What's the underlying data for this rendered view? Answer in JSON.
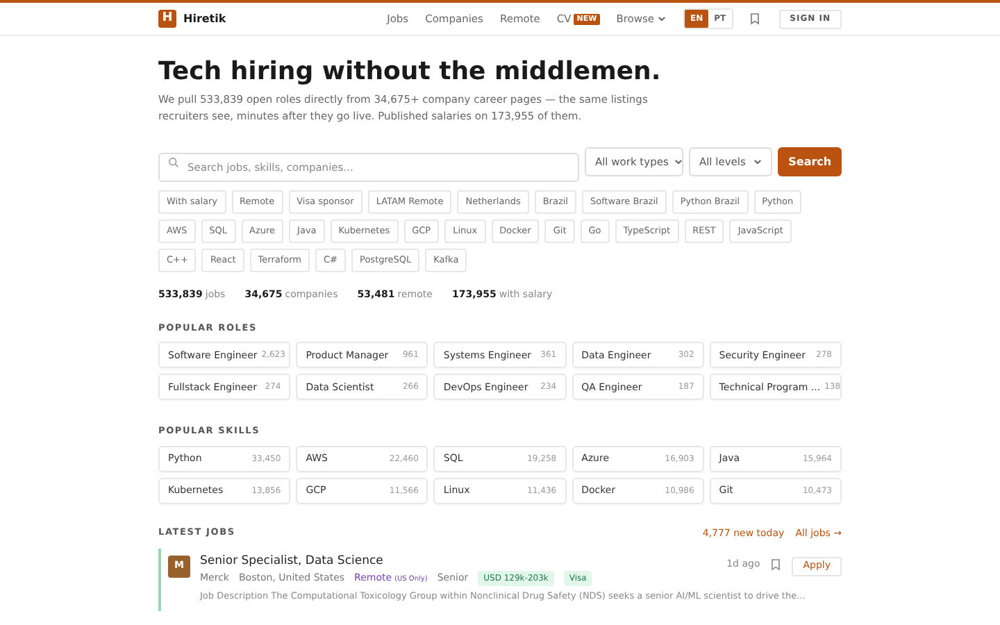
{
  "header": {
    "logo_letter": "H",
    "brand": "Hiretik",
    "nav": [
      {
        "label": "Jobs",
        "kind": "link"
      },
      {
        "label": "Companies",
        "kind": "link"
      },
      {
        "label": "Remote",
        "kind": "link"
      },
      {
        "label": "CV",
        "kind": "badge",
        "badge": "NEW"
      },
      {
        "label": "Browse",
        "kind": "menu"
      }
    ],
    "languages": [
      {
        "label": "EN",
        "selected": true
      },
      {
        "label": "PT",
        "selected": false
      }
    ],
    "sign_in": "SIGN IN"
  },
  "hero": {
    "title": "Tech hiring without the middlemen.",
    "subtitle": "We pull 533,839 open roles directly from 34,675+ company career pages — the same listings recruiters see, minutes after they go live. Published salaries on 173,955 of them."
  },
  "search": {
    "placeholder": "Search jobs, skills, companies...",
    "work_type": "All work types",
    "level": "All levels",
    "button": "Search"
  },
  "chips": [
    "With salary",
    "Remote",
    "Visa sponsor",
    "LATAM Remote",
    "Netherlands",
    "Brazil",
    "Software Brazil",
    "Python Brazil",
    "Python",
    "AWS",
    "SQL",
    "Azure",
    "Java",
    "Kubernetes",
    "GCP",
    "Linux",
    "Docker",
    "Git",
    "Go",
    "TypeScript",
    "REST",
    "JavaScript",
    "C++",
    "React",
    "Terraform",
    "C#",
    "PostgreSQL",
    "Kafka"
  ],
  "stats": [
    {
      "value": "533,839",
      "label": "jobs"
    },
    {
      "value": "34,675",
      "label": "companies"
    },
    {
      "value": "53,481",
      "label": "remote"
    },
    {
      "value": "173,955",
      "label": "with salary"
    }
  ],
  "popular_roles": {
    "title": "POPULAR ROLES",
    "items": [
      {
        "name": "Software Engineer",
        "count": "2,623"
      },
      {
        "name": "Product Manager",
        "count": "961"
      },
      {
        "name": "Systems Engineer",
        "count": "361"
      },
      {
        "name": "Data Engineer",
        "count": "302"
      },
      {
        "name": "Security Engineer",
        "count": "278"
      },
      {
        "name": "Fullstack Engineer",
        "count": "274"
      },
      {
        "name": "Data Scientist",
        "count": "266"
      },
      {
        "name": "DevOps Engineer",
        "count": "234"
      },
      {
        "name": "QA Engineer",
        "count": "187"
      },
      {
        "name": "Technical Program ...",
        "count": "138"
      }
    ]
  },
  "popular_skills": {
    "title": "POPULAR SKILLS",
    "items": [
      {
        "name": "Python",
        "count": "33,450"
      },
      {
        "name": "AWS",
        "count": "22,460"
      },
      {
        "name": "SQL",
        "count": "19,258"
      },
      {
        "name": "Azure",
        "count": "16,903"
      },
      {
        "name": "Java",
        "count": "15,964"
      },
      {
        "name": "Kubernetes",
        "count": "13,856"
      },
      {
        "name": "GCP",
        "count": "11,566"
      },
      {
        "name": "Linux",
        "count": "11,436"
      },
      {
        "name": "Docker",
        "count": "10,986"
      },
      {
        "name": "Git",
        "count": "10,473"
      }
    ]
  },
  "latest_jobs": {
    "title": "LATEST JOBS",
    "new_today": "4,777 new today",
    "all_jobs": "All jobs →",
    "jobs": [
      {
        "avatar": "M",
        "title": "Senior Specialist, Data Science",
        "age": "1d ago",
        "apply": "Apply",
        "meta": [
          {
            "kind": "text",
            "text": "Merck"
          },
          {
            "kind": "text",
            "text": "Boston, United States"
          },
          {
            "kind": "remote",
            "text": "Remote",
            "note": "(US Only)"
          },
          {
            "kind": "text",
            "text": "Senior"
          },
          {
            "kind": "tag",
            "text": "USD 129k-203k"
          },
          {
            "kind": "tag",
            "text": "Visa"
          }
        ],
        "description": "Job Description The Computational Toxicology Group within Nonclinical Drug Safety (NDS) seeks a senior AI/ML scientist to drive the..."
      }
    ]
  }
}
